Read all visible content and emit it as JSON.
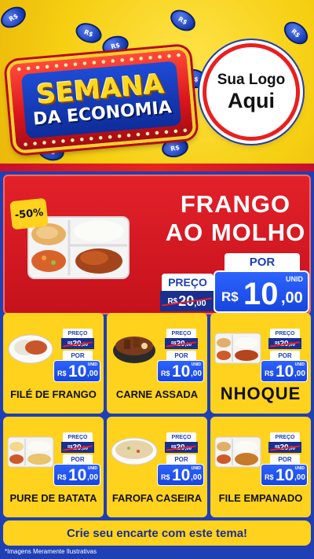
{
  "header": {
    "title_line1": "SEMANA",
    "title_line2": "DA ECONOMIA",
    "logo_line1": "Sua Logo",
    "logo_line2": "Aqui",
    "coin_label": "R$"
  },
  "featured": {
    "discount": "-50%",
    "name_line1": "FRANGO",
    "name_line2": "AO MOLHO",
    "preco_label": "PREÇO",
    "old_currency": "R$",
    "old_int": "20",
    "old_dec": ",00",
    "por_label": "POR",
    "unit_label": "UNID",
    "new_currency": "R$",
    "new_int": "10",
    "new_dec": ",00"
  },
  "price_labels": {
    "preco": "PREÇO",
    "por": "POR",
    "unid": "UNID",
    "currency": "R$"
  },
  "products": [
    {
      "name": "FILÉ DE FRANGO",
      "old_int": "20",
      "old_dec": ",00",
      "new_int": "10",
      "new_dec": ",00"
    },
    {
      "name": "CARNE ASSADA",
      "old_int": "20",
      "old_dec": ",00",
      "new_int": "10",
      "new_dec": ",00"
    },
    {
      "name": "NHOQUE",
      "old_int": "20",
      "old_dec": ",00",
      "new_int": "10",
      "new_dec": ",00"
    },
    {
      "name": "PURE DE BATATA",
      "old_int": "20",
      "old_dec": ",00",
      "new_int": "10",
      "new_dec": ",00"
    },
    {
      "name": "FAROFA CASEIRA",
      "old_int": "20",
      "old_dec": ",00",
      "new_int": "10",
      "new_dec": ",00"
    },
    {
      "name": "FILE EMPANADO",
      "old_int": "20",
      "old_dec": ",00",
      "new_int": "10",
      "new_dec": ",00"
    }
  ],
  "footer": {
    "cta": "Crie seu encarte com este tema!",
    "disclaimer": "*Imagens Meramente Ilustrativas"
  },
  "colors": {
    "yellow": "#ffd21e",
    "blue": "#1f3fb4",
    "red": "#e3212a",
    "price_blue": "#2e63ff"
  }
}
